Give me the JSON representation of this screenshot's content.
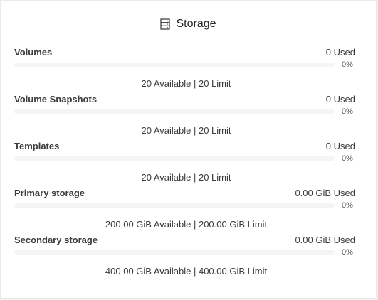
{
  "card": {
    "title": "Storage",
    "icon": "database-icon"
  },
  "sections": [
    {
      "title": "Volumes",
      "used": "0 Used",
      "percent_label": "0%",
      "percent": 0,
      "availability": "20 Available | 20 Limit"
    },
    {
      "title": "Volume Snapshots",
      "used": "0 Used",
      "percent_label": "0%",
      "percent": 0,
      "availability": "20 Available | 20 Limit"
    },
    {
      "title": "Templates",
      "used": "0 Used",
      "percent_label": "0%",
      "percent": 0,
      "availability": "20 Available | 20 Limit"
    },
    {
      "title": "Primary storage",
      "used": "0.00 GiB Used",
      "percent_label": "0%",
      "percent": 0,
      "availability": "200.00 GiB Available | 200.00 GiB Limit"
    },
    {
      "title": "Secondary storage",
      "used": "0.00 GiB Used",
      "percent_label": "0%",
      "percent": 0,
      "availability": "400.00 GiB Available | 400.00 GiB Limit"
    }
  ]
}
